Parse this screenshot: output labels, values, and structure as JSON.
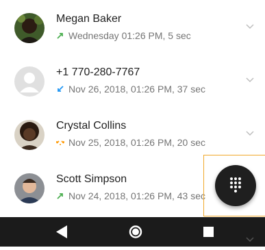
{
  "calls": [
    {
      "name": "Megan Baker",
      "detail": "Wednesday 01:26 PM, 5 sec",
      "call_type_icon": "outgoing-call-icon",
      "call_color": "#4caf50"
    },
    {
      "name": "+1 770-280-7767",
      "detail": "Nov 26, 2018, 01:26 PM, 37 sec",
      "call_type_icon": "incoming-call-icon",
      "call_color": "#2196f3"
    },
    {
      "name": "Crystal Collins",
      "detail": "Nov 25, 2018, 01:26 PM, 20 sec",
      "call_type_icon": "conference-call-icon",
      "call_color": "#ff9800"
    },
    {
      "name": "Scott Simpson",
      "detail": "Nov 24, 2018, 01:26 PM, 43 sec",
      "call_type_icon": "outgoing-call-icon",
      "call_color": "#4caf50"
    }
  ],
  "fab": {
    "icon": "dialpad-icon"
  },
  "navigation": {
    "back_icon": "back-triangle-icon",
    "home_icon": "home-circle-icon",
    "recents_icon": "recents-square-icon"
  },
  "colors": {
    "fab_background": "#1f1f1f",
    "nav_background": "#1b1b1b",
    "highlight_border": "#f0a92a"
  }
}
